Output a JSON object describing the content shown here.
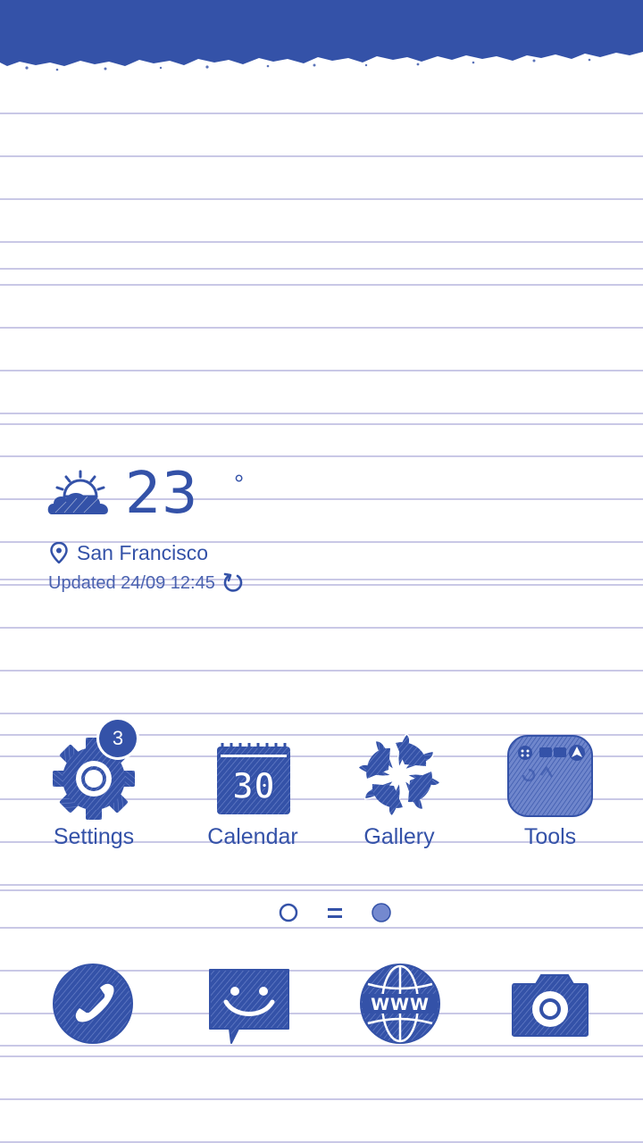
{
  "colors": {
    "accent": "#3452a8",
    "paper": "#ffffff",
    "rule_line": "#c9c8e6"
  },
  "weather": {
    "icon": "partly-cloudy-icon",
    "temperature": "23",
    "degree_symbol": "°",
    "location": "San Francisco",
    "updated": "Updated 24/09 12:45"
  },
  "apps": [
    {
      "label": "Settings",
      "icon": "gear-icon",
      "badge": "3"
    },
    {
      "label": "Calendar",
      "icon": "calendar-icon",
      "date": "30"
    },
    {
      "label": "Gallery",
      "icon": "gallery-flower-icon"
    },
    {
      "label": "Tools",
      "icon": "tools-folder-icon"
    }
  ],
  "pager": {
    "pages": 3,
    "active_page": 2
  },
  "dock": [
    {
      "icon": "phone-icon"
    },
    {
      "icon": "messages-icon"
    },
    {
      "icon": "browser-globe-icon",
      "text": "WWW"
    },
    {
      "icon": "camera-icon"
    }
  ]
}
